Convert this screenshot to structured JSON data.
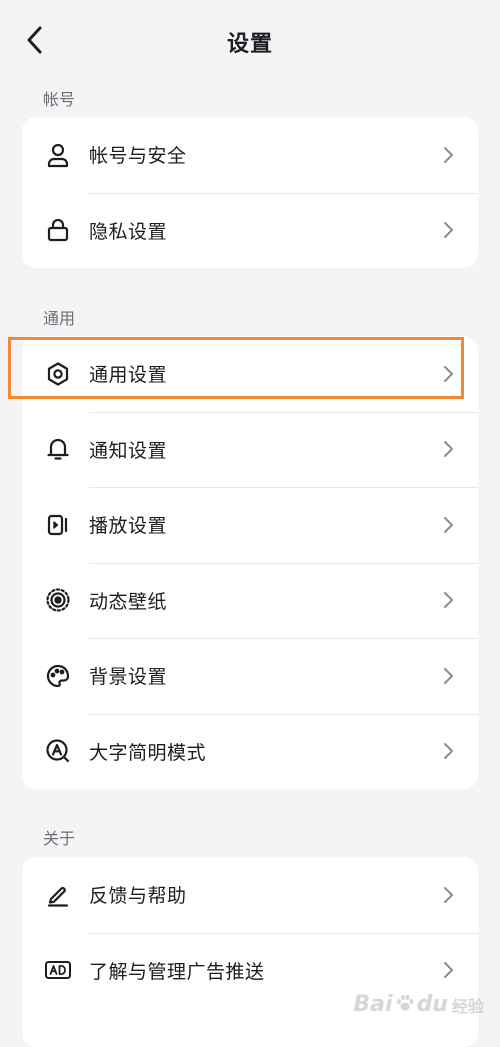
{
  "header": {
    "title": "设置"
  },
  "sections": [
    {
      "label": "帐号",
      "items": [
        {
          "label": "帐号与安全",
          "icon": "user-icon"
        },
        {
          "label": "隐私设置",
          "icon": "lock-icon"
        }
      ]
    },
    {
      "label": "通用",
      "items": [
        {
          "label": "通用设置",
          "icon": "gear-icon"
        },
        {
          "label": "通知设置",
          "icon": "bell-icon"
        },
        {
          "label": "播放设置",
          "icon": "play-device-icon"
        },
        {
          "label": "动态壁纸",
          "icon": "live-wallpaper-icon"
        },
        {
          "label": "背景设置",
          "icon": "palette-icon"
        },
        {
          "label": "大字简明模式",
          "icon": "large-text-icon"
        }
      ]
    },
    {
      "label": "关于",
      "items": [
        {
          "label": "反馈与帮助",
          "icon": "pencil-icon"
        },
        {
          "label": "了解与管理广告推送",
          "icon": "ad-icon"
        }
      ]
    }
  ],
  "highlight_color": "#f08a34",
  "watermark": {
    "brand": "Bai",
    "brand_end": "du",
    "sub": "经验"
  }
}
